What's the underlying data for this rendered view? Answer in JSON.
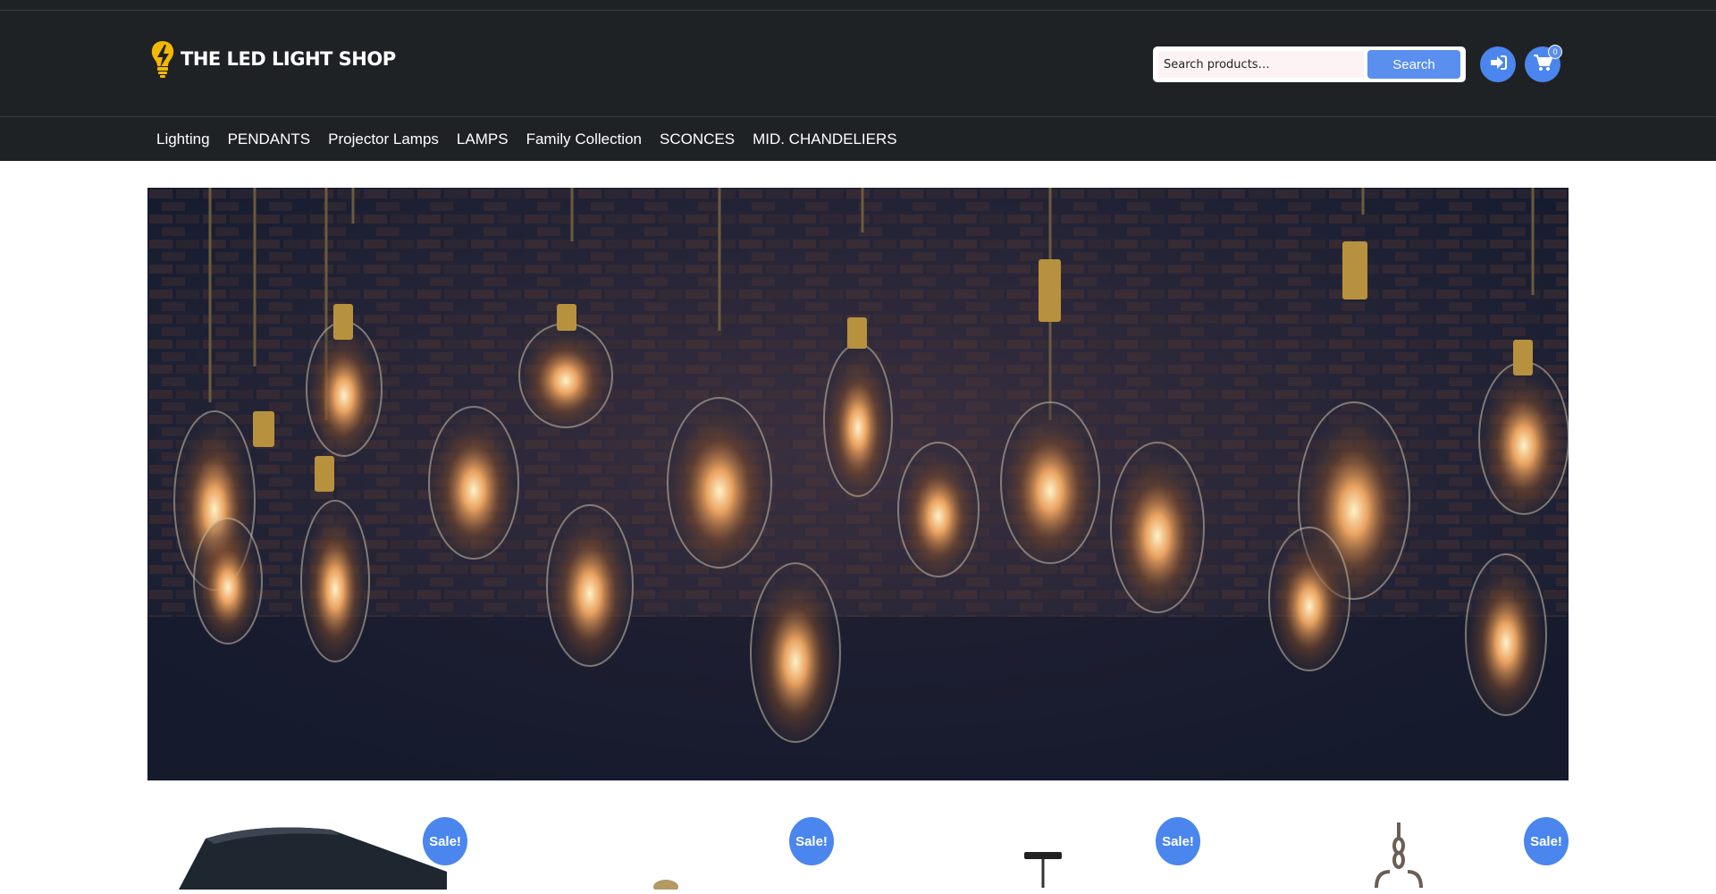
{
  "brand": {
    "name": "THE LED LIGHT SHOP",
    "logo_icon": "lightbulb-bolt-icon",
    "accent": "#F5B800"
  },
  "search": {
    "placeholder": "Search products…",
    "button_label": "Search"
  },
  "header_actions": {
    "login_icon": "sign-in-icon",
    "cart_icon": "cart-icon",
    "cart_count": "0"
  },
  "nav": {
    "items": [
      {
        "label": "Lighting"
      },
      {
        "label": "PENDANTS"
      },
      {
        "label": "Projector Lamps"
      },
      {
        "label": "LAMPS"
      },
      {
        "label": "Family Collection"
      },
      {
        "label": "SCONCES"
      },
      {
        "label": "MID. CHANDELIERS"
      }
    ]
  },
  "hero": {
    "image": "hanging-edison-bulbs-banner"
  },
  "products": [
    {
      "badge": "Sale!",
      "image": "black-lantern-fixture"
    },
    {
      "badge": "Sale!",
      "image": "brass-pendant"
    },
    {
      "badge": "Sale!",
      "image": "black-pendant-fixture"
    },
    {
      "badge": "Sale!",
      "image": "chain-chandelier"
    }
  ],
  "colors": {
    "header_bg": "#1F2225",
    "button_blue": "#5A8FF0",
    "badge_blue": "#4A86EE"
  }
}
